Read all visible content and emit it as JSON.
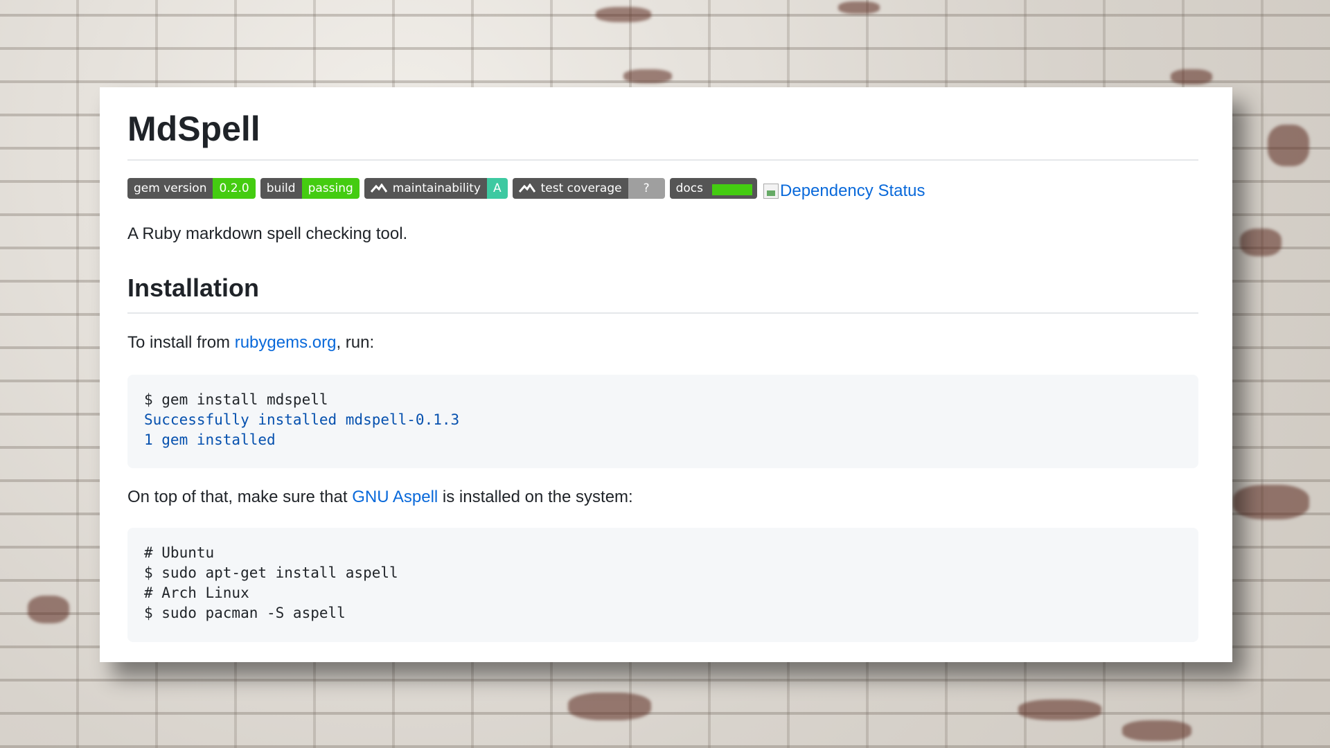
{
  "title": "MdSpell",
  "badges": {
    "gem": {
      "label": "gem version",
      "value": "0.2.0"
    },
    "build": {
      "label": "build",
      "value": "passing"
    },
    "maintainability": {
      "label": "maintainability",
      "value": "A"
    },
    "coverage": {
      "label": "test coverage",
      "value": "?"
    },
    "docs": {
      "label": "docs"
    },
    "dependency": {
      "alt": "Dependency Status"
    }
  },
  "description": "A Ruby markdown spell checking tool.",
  "installation": {
    "heading": "Installation",
    "intro_prefix": "To install from ",
    "intro_link": "rubygems.org",
    "intro_suffix": ", run:",
    "code1": {
      "command": "$ gem install mdspell",
      "output": [
        "Successfully installed mdspell-0.1.3",
        "1 gem installed"
      ]
    },
    "aspell_prefix": "On top of that, make sure that ",
    "aspell_link": "GNU Aspell",
    "aspell_suffix": " is installed on the system:",
    "code2": {
      "lines": [
        "# Ubuntu",
        "$ sudo apt-get install aspell",
        "# Arch Linux",
        "$ sudo pacman -S aspell"
      ]
    }
  },
  "colors": {
    "link": "#0969da",
    "badge_green": "#44cc11",
    "badge_teal": "#3dc9a1",
    "badge_dark": "#555555"
  }
}
